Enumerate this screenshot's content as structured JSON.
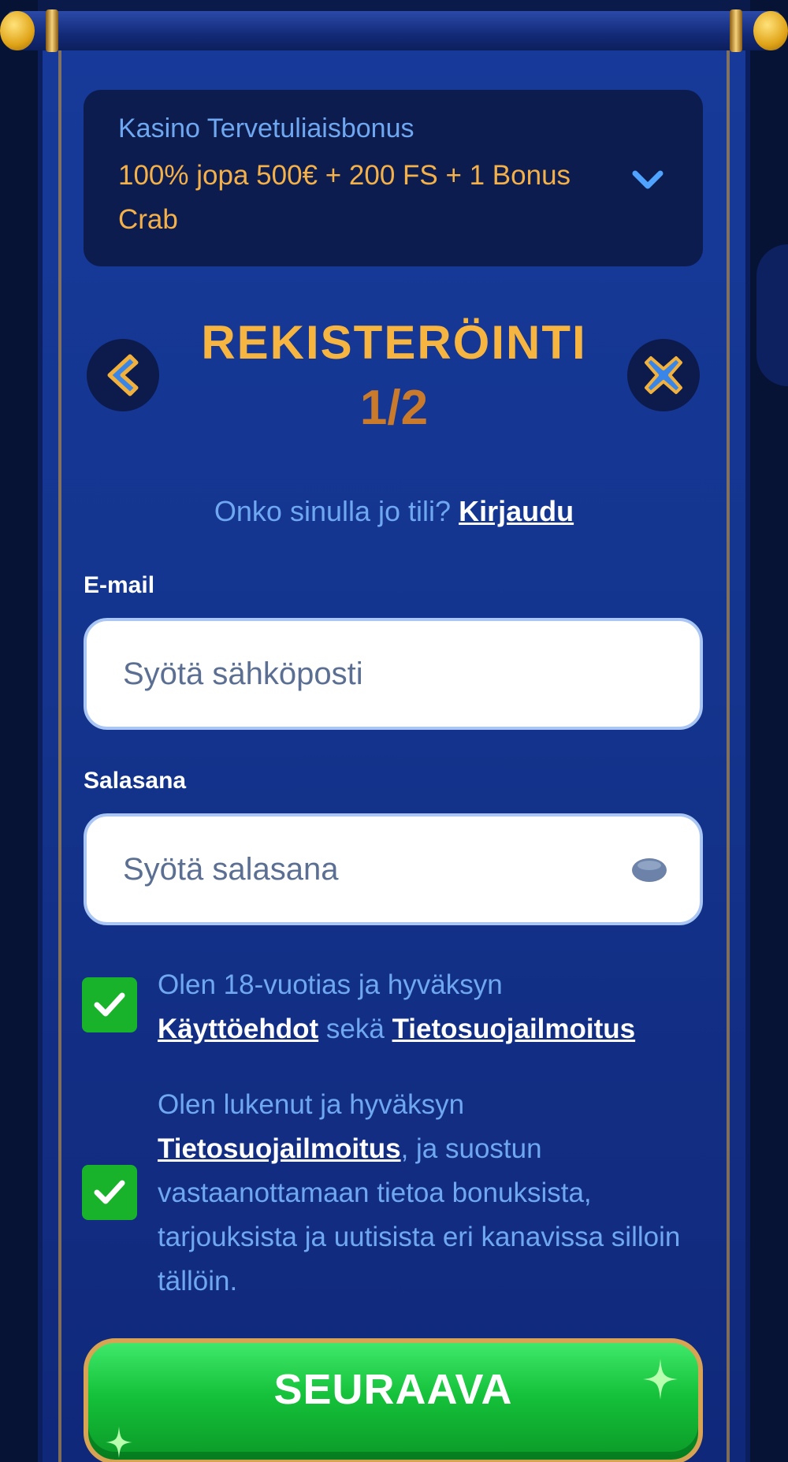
{
  "bonus": {
    "title": "Kasino Tervetuliaisbonus",
    "offer": "100% jopa 500€ + 200 FS + 1 Bonus Crab"
  },
  "header": {
    "title": "REKISTERÖINTI",
    "step": "1/2"
  },
  "login_prompt": {
    "text": "Onko sinulla jo tili?",
    "link": "Kirjaudu"
  },
  "form": {
    "email_label": "E-mail",
    "email_placeholder": "Syötä sähköposti",
    "password_label": "Salasana",
    "password_placeholder": "Syötä salasana"
  },
  "consents": [
    {
      "checked": true,
      "text_1": "Olen 18-vuotias ja hyväksyn",
      "link_1": "Käyttöehdot",
      "text_2": "sekä",
      "link_2": "Tietosuojailmoitus"
    },
    {
      "checked": true,
      "text_1": "Olen lukenut ja hyväksyn",
      "link_1": "Tietosuojailmoitus",
      "text_2": ", ja suostun vastaanottamaan tietoa bonuksista, tarjouksista ja uutisista eri kanavissa silloin tällöin."
    }
  ],
  "next_button": "SEURAAVA",
  "colors": {
    "accent_gold": "#f5b540",
    "link_blue": "#6fa8f0",
    "check_green": "#18b32a",
    "button_green": "#15c13a"
  }
}
